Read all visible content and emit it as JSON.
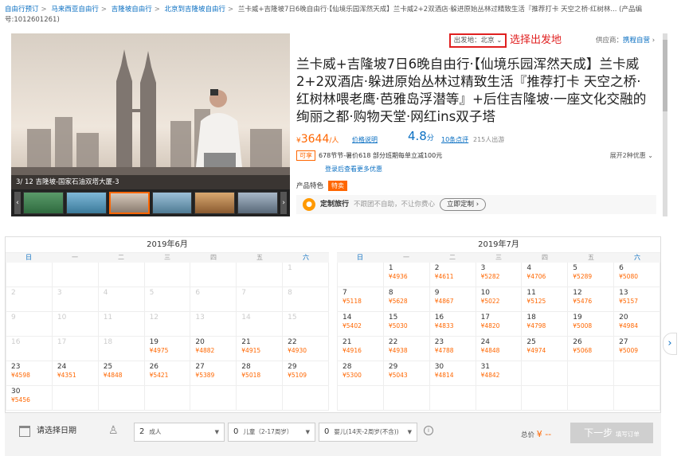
{
  "breadcrumb": {
    "items": [
      "自由行预订",
      "马来西亚自由行",
      "吉隆坡自由行",
      "北京到吉隆坡自由行"
    ],
    "current": "兰卡威+吉隆坡7日6晚自由行·【仙境乐园浑然天成】兰卡威2+2双酒店·躲进原始丛林过精致生活『推荐打卡 天空之桥·红树林... (产品编号:1012601261)"
  },
  "gallery": {
    "caption": "3/ 12  吉隆坡-国家石油双塔大厦-3"
  },
  "depart": {
    "label": "出发地：北京",
    "hint": "选择出发地"
  },
  "supplier": {
    "label": "供应商：",
    "name": "携程自营"
  },
  "product": {
    "title": "兰卡威+吉隆坡7日6晚自由行·【仙境乐园浑然天成】兰卡威2+2双酒店·躲进原始丛林过精致生活『推荐打卡 天空之桥·红树林喂老鹰·芭雅岛浮潜等』+后住吉隆坡·一座文化交融的绚丽之都·购物天堂·网红ins双子塔",
    "price_symbol": "¥",
    "price": "3644",
    "price_unit": "/人",
    "price_note": "价格说明",
    "score": "4.8",
    "score_unit": "分",
    "reviews": "10条点评",
    "sold": "215人出游",
    "promo_tag": "可享",
    "promo_text": "678节节-暑价618 部分班期每单立减100元",
    "promo_more": "展开2种优惠",
    "login_link": "登录",
    "login_text": "后查看更多优惠",
    "feature_label": "产品特色",
    "feature_tag": "特卖",
    "custom_label": "定制旅行",
    "custom_desc": "不跟团不自助，不让你费心",
    "custom_btn": "立即定制 ›"
  },
  "weekdays": [
    "日",
    "一",
    "二",
    "三",
    "四",
    "五",
    "六"
  ],
  "calendar": [
    {
      "title": "2019年6月",
      "cells": [
        {
          "d": "",
          "p": ""
        },
        {
          "d": "",
          "p": ""
        },
        {
          "d": "",
          "p": ""
        },
        {
          "d": "",
          "p": ""
        },
        {
          "d": "",
          "p": ""
        },
        {
          "d": "",
          "p": ""
        },
        {
          "d": "1",
          "p": "",
          "dim": true
        },
        {
          "d": "2",
          "p": "",
          "dim": true
        },
        {
          "d": "3",
          "p": "",
          "dim": true
        },
        {
          "d": "4",
          "p": "",
          "dim": true
        },
        {
          "d": "5",
          "p": "",
          "dim": true
        },
        {
          "d": "6",
          "p": "",
          "dim": true
        },
        {
          "d": "7",
          "p": "",
          "dim": true
        },
        {
          "d": "8",
          "p": "",
          "dim": true
        },
        {
          "d": "9",
          "p": "",
          "dim": true
        },
        {
          "d": "10",
          "p": "",
          "dim": true
        },
        {
          "d": "11",
          "p": "",
          "dim": true
        },
        {
          "d": "12",
          "p": "",
          "dim": true
        },
        {
          "d": "13",
          "p": "",
          "dim": true
        },
        {
          "d": "14",
          "p": "",
          "dim": true
        },
        {
          "d": "15",
          "p": "",
          "dim": true
        },
        {
          "d": "16",
          "p": "",
          "dim": true
        },
        {
          "d": "17",
          "p": "",
          "dim": true
        },
        {
          "d": "18",
          "p": "",
          "dim": true
        },
        {
          "d": "19",
          "p": "¥4975"
        },
        {
          "d": "20",
          "p": "¥4882"
        },
        {
          "d": "21",
          "p": "¥4915"
        },
        {
          "d": "22",
          "p": "¥4930"
        },
        {
          "d": "23",
          "p": "¥4598"
        },
        {
          "d": "24",
          "p": "¥4351"
        },
        {
          "d": "25",
          "p": "¥4848"
        },
        {
          "d": "26",
          "p": "¥5421"
        },
        {
          "d": "27",
          "p": "¥5389"
        },
        {
          "d": "28",
          "p": "¥5018"
        },
        {
          "d": "29",
          "p": "¥5109"
        },
        {
          "d": "30",
          "p": "¥5456"
        },
        {
          "d": "",
          "p": ""
        },
        {
          "d": "",
          "p": ""
        },
        {
          "d": "",
          "p": ""
        },
        {
          "d": "",
          "p": ""
        },
        {
          "d": "",
          "p": ""
        },
        {
          "d": "",
          "p": ""
        }
      ]
    },
    {
      "title": "2019年7月",
      "cells": [
        {
          "d": "",
          "p": ""
        },
        {
          "d": "1",
          "p": "¥4936"
        },
        {
          "d": "2",
          "p": "¥4611"
        },
        {
          "d": "3",
          "p": "¥5282"
        },
        {
          "d": "4",
          "p": "¥4706"
        },
        {
          "d": "5",
          "p": "¥5289"
        },
        {
          "d": "6",
          "p": "¥5080"
        },
        {
          "d": "7",
          "p": "¥5118"
        },
        {
          "d": "8",
          "p": "¥5628"
        },
        {
          "d": "9",
          "p": "¥4867"
        },
        {
          "d": "10",
          "p": "¥5022"
        },
        {
          "d": "11",
          "p": "¥5125"
        },
        {
          "d": "12",
          "p": "¥5476"
        },
        {
          "d": "13",
          "p": "¥5157"
        },
        {
          "d": "14",
          "p": "¥5402"
        },
        {
          "d": "15",
          "p": "¥5030"
        },
        {
          "d": "16",
          "p": "¥4833"
        },
        {
          "d": "17",
          "p": "¥4820"
        },
        {
          "d": "18",
          "p": "¥4798"
        },
        {
          "d": "19",
          "p": "¥5008"
        },
        {
          "d": "20",
          "p": "¥4984"
        },
        {
          "d": "21",
          "p": "¥4916"
        },
        {
          "d": "22",
          "p": "¥4938"
        },
        {
          "d": "23",
          "p": "¥4788"
        },
        {
          "d": "24",
          "p": "¥4848"
        },
        {
          "d": "25",
          "p": "¥4974"
        },
        {
          "d": "26",
          "p": "¥5068"
        },
        {
          "d": "27",
          "p": "¥5009"
        },
        {
          "d": "28",
          "p": "¥5300"
        },
        {
          "d": "29",
          "p": "¥5043"
        },
        {
          "d": "30",
          "p": "¥4814"
        },
        {
          "d": "31",
          "p": "¥4842"
        },
        {
          "d": "",
          "p": ""
        },
        {
          "d": "",
          "p": ""
        },
        {
          "d": "",
          "p": ""
        },
        {
          "d": "",
          "p": ""
        },
        {
          "d": "",
          "p": ""
        },
        {
          "d": "",
          "p": ""
        },
        {
          "d": "",
          "p": ""
        },
        {
          "d": "",
          "p": ""
        },
        {
          "d": "",
          "p": ""
        },
        {
          "d": "",
          "p": ""
        }
      ]
    }
  ],
  "booking": {
    "date_label": "请选择日期",
    "adults_num": "2",
    "adults_label": "成人",
    "children_num": "0",
    "children_label": "儿童（2-17周岁）",
    "infants_num": "0",
    "infants_label": "婴儿(14天-2周岁(不含))",
    "total_label": "总价",
    "total_value": "¥ --",
    "next_label": "下一步",
    "next_sub": "填写订单"
  },
  "colors": {
    "accent": "#ff6600",
    "link": "#0a6fc2",
    "highlight": "#e02020"
  }
}
